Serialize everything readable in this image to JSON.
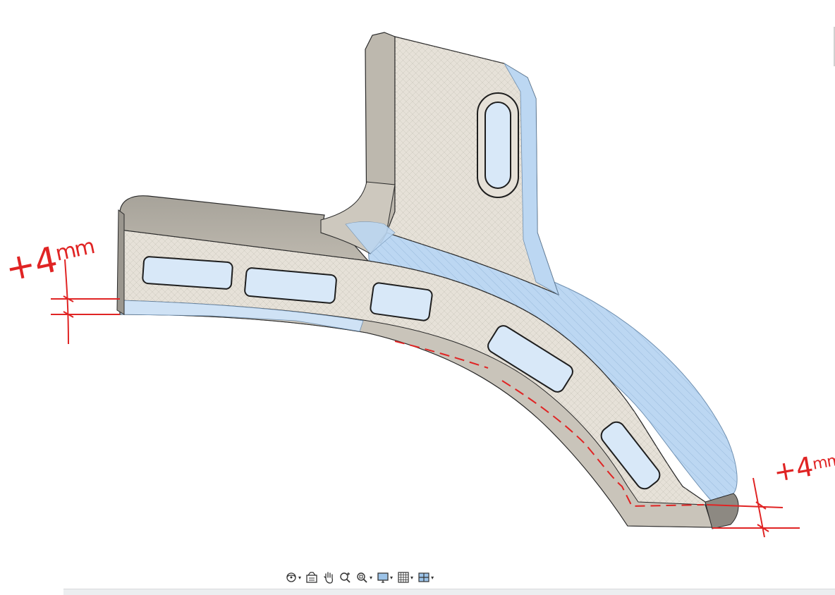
{
  "viewport": {
    "background_color": "#ffffff",
    "model": {
      "name": "curved-bracket-part",
      "face_color": "#e6e1d8",
      "highlight_color": "#bcd7f2",
      "shadow_color": "#a9a59c",
      "edge_color": "#2a2a2a"
    }
  },
  "annotations": {
    "color": "#e02424",
    "left_dimension": {
      "sign": "+",
      "value": "4",
      "unit": "mm"
    },
    "right_dimension": {
      "sign": "+",
      "value": "4",
      "unit": "mm"
    }
  },
  "toolbar": {
    "items": [
      {
        "name": "orbit",
        "icon": "orbit-icon",
        "has_dropdown": true
      },
      {
        "name": "look-at",
        "icon": "look-at-icon",
        "has_dropdown": false
      },
      {
        "name": "pan",
        "icon": "pan-hand-icon",
        "has_dropdown": false
      },
      {
        "name": "zoom",
        "icon": "zoom-icon",
        "has_dropdown": false
      },
      {
        "name": "fit",
        "icon": "zoom-window-icon",
        "has_dropdown": true
      },
      {
        "name": "display-settings",
        "icon": "display-monitor-icon",
        "has_dropdown": true
      },
      {
        "name": "grid-settings",
        "icon": "grid-icon",
        "has_dropdown": true
      },
      {
        "name": "viewports",
        "icon": "viewports-icon",
        "has_dropdown": true
      }
    ]
  }
}
